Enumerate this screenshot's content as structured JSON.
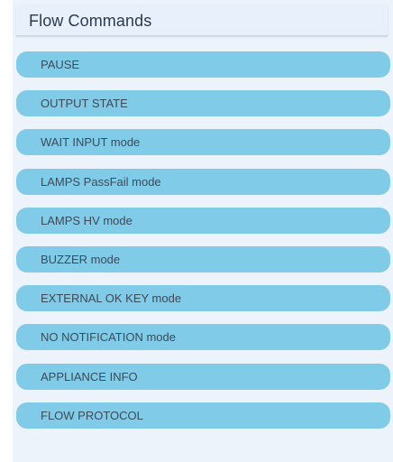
{
  "panel": {
    "title": "Flow Commands"
  },
  "commands": [
    {
      "label": "PAUSE"
    },
    {
      "label": "OUTPUT STATE"
    },
    {
      "label": "WAIT INPUT mode"
    },
    {
      "label": "LAMPS PassFail mode"
    },
    {
      "label": "LAMPS HV mode"
    },
    {
      "label": "BUZZER mode"
    },
    {
      "label": "EXTERNAL OK KEY mode"
    },
    {
      "label": "NO NOTIFICATION mode"
    },
    {
      "label": "APPLIANCE INFO"
    },
    {
      "label": "FLOW PROTOCOL"
    }
  ],
  "colors": {
    "panel_background": "#edf3fb",
    "button_background": "#80cbe8",
    "button_text": "#3e4a57",
    "title_text": "#2b3a52"
  }
}
